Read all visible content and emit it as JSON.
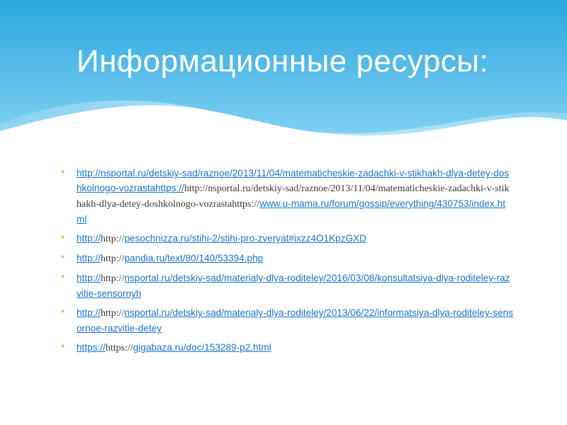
{
  "slide": {
    "title": "Информационные ресурсы:",
    "bullet_symbol": "*",
    "colors": {
      "header_top": "#2da6df",
      "header_bottom": "#7fd0f2",
      "link": "#1a73c9",
      "bullet": "#f08a2c",
      "text": "#3a3a3a"
    },
    "items": [
      {
        "parts": [
          {
            "text": "http://nsportal.ru/detskiy-sad/raznoe/2013/11/04/matematicheskie-zadachki-v-stikhakh-dlya-detey-doshkolnogo-vozrastahttps://",
            "link": true
          },
          {
            "text": "http://nsportal.ru/detskiy-sad/raznoe/2013/11/04/matematicheskie-zadachki-v-stikhakh-dlya-detey-doshkolnogo-vozrastahttps://",
            "link": false
          },
          {
            "text": "www.u-mama.ru/forum/gossip/everything/430753/index.html",
            "link": true
          }
        ]
      },
      {
        "parts": [
          {
            "text": "http://",
            "link": true
          },
          {
            "text": "http://",
            "link": false
          },
          {
            "text": "pesochnizza.ru/stihi-2/stihi-pro-zveryat#ixzz4O1KpzGXD",
            "link": true
          }
        ]
      },
      {
        "parts": [
          {
            "text": "http://",
            "link": true
          },
          {
            "text": "http://",
            "link": false
          },
          {
            "text": "pandia.ru/text/80/140/53394.php",
            "link": true
          }
        ]
      },
      {
        "parts": [
          {
            "text": "http://",
            "link": true
          },
          {
            "text": "http://",
            "link": false
          },
          {
            "text": "nsportal.ru/detskiy-sad/materialy-dlya-roditeley/2016/03/08/konsultatsiya-dlya-roditeley-razvitie-sensornyh",
            "link": true
          }
        ]
      },
      {
        "parts": [
          {
            "text": "http://",
            "link": true
          },
          {
            "text": "http://",
            "link": false
          },
          {
            "text": "nsportal.ru/detskiy-sad/materialy-dlya-roditeley/2013/06/22/informatsiya-dlya-roditeley-sensornoe-razvitie-detey",
            "link": true
          }
        ]
      },
      {
        "parts": [
          {
            "text": "https://",
            "link": true
          },
          {
            "text": "https://",
            "link": false
          },
          {
            "text": "gigabaza.ru/doc/153289-p2.html",
            "link": true
          }
        ]
      }
    ]
  }
}
